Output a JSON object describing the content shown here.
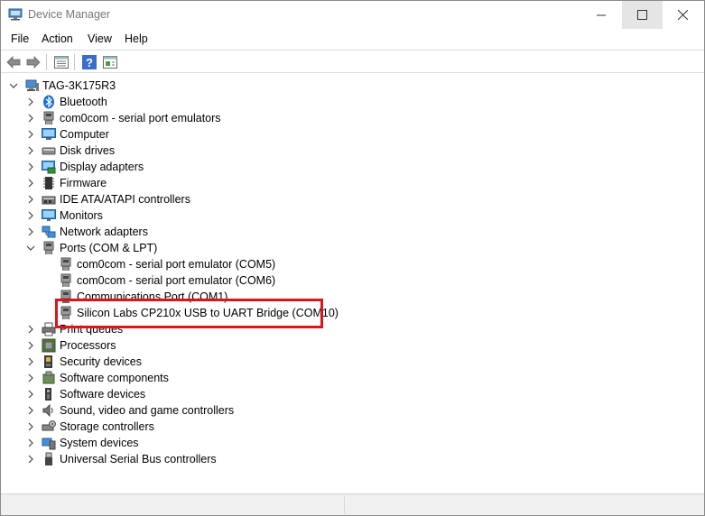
{
  "window": {
    "title": "Device Manager",
    "minimize_glyph": "—",
    "maximize_glyph": "☐",
    "close_glyph": "✕"
  },
  "menu": {
    "file": "File",
    "action": "Action",
    "view": "View",
    "help": "Help"
  },
  "toolbar": {
    "icons": [
      "back-arrow-icon",
      "forward-arrow-icon",
      "properties-icon",
      "help-icon",
      "update-driver-icon"
    ]
  },
  "tree": {
    "root": "TAG-3K175R3",
    "categories": [
      {
        "label": "Bluetooth",
        "icon": "bluetooth-icon"
      },
      {
        "label": "com0com - serial port emulators",
        "icon": "port-icon"
      },
      {
        "label": "Computer",
        "icon": "computer-icon"
      },
      {
        "label": "Disk drives",
        "icon": "disk-icon"
      },
      {
        "label": "Display adapters",
        "icon": "display-adapter-icon"
      },
      {
        "label": "Firmware",
        "icon": "firmware-icon"
      },
      {
        "label": "IDE ATA/ATAPI controllers",
        "icon": "ide-controller-icon"
      },
      {
        "label": "Monitors",
        "icon": "monitor-icon"
      },
      {
        "label": "Network adapters",
        "icon": "network-icon"
      },
      {
        "label": "Ports (COM & LPT)",
        "icon": "port-icon",
        "expanded": true,
        "children": [
          "com0com - serial port emulator (COM5)",
          "com0com - serial port emulator (COM6)",
          "Communications Port (COM1)",
          "Silicon Labs CP210x USB to UART Bridge (COM10)"
        ]
      },
      {
        "label": "Print queues",
        "icon": "printer-icon"
      },
      {
        "label": "Processors",
        "icon": "processor-icon"
      },
      {
        "label": "Security devices",
        "icon": "security-icon"
      },
      {
        "label": "Software components",
        "icon": "software-component-icon"
      },
      {
        "label": "Software devices",
        "icon": "software-device-icon"
      },
      {
        "label": "Sound, video and game controllers",
        "icon": "sound-icon"
      },
      {
        "label": "Storage controllers",
        "icon": "storage-icon"
      },
      {
        "label": "System devices",
        "icon": "system-icon"
      },
      {
        "label": "Universal Serial Bus controllers",
        "icon": "usb-icon"
      }
    ]
  },
  "colors": {
    "highlight": "#d9161c",
    "selection_max_bg": "#e5e5e5"
  }
}
